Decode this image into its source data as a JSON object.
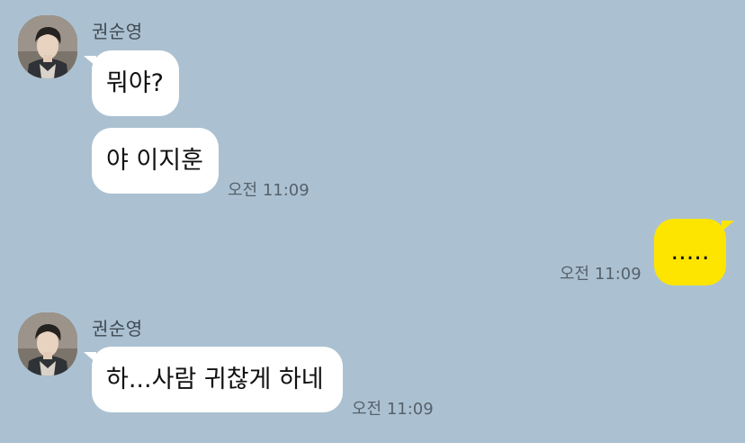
{
  "messages": [
    {
      "sender": "권순영",
      "text": "뭐야?"
    },
    {
      "text": "야 이지훈",
      "time": "오전 11:09"
    },
    {
      "text": ".....",
      "time": "오전 11:09"
    },
    {
      "sender": "권순영",
      "text": "하...사람 귀찮게 하네",
      "time": "오전 11:09"
    }
  ],
  "colors": {
    "background": "#abc1d1",
    "incoming_bubble": "#ffffff",
    "outgoing_bubble": "#fee500",
    "name_text": "#3f4a54",
    "timestamp_text": "#56616b"
  },
  "icons": {
    "avatar": "profile-photo-avatar"
  }
}
